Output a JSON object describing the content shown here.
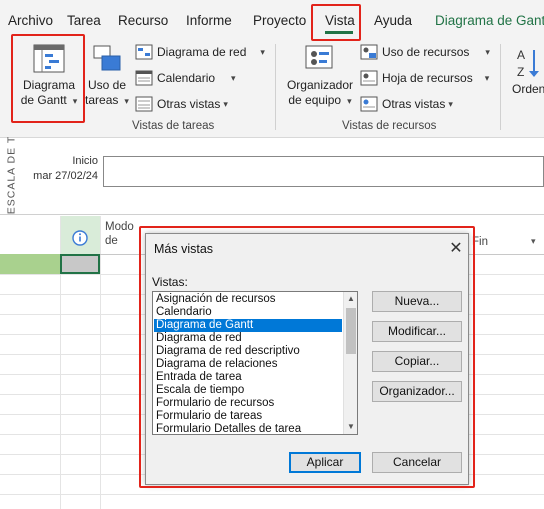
{
  "menu": {
    "items": [
      "Archivo",
      "Tarea",
      "Recurso",
      "Informe",
      "Proyecto",
      "Vista",
      "Ayuda"
    ],
    "context_tab": "Diagrama de Gantt",
    "active": "Vista"
  },
  "ribbon": {
    "task_views": {
      "gantt_label": "Diagrama de Gantt",
      "gantt_label_line1": "Diagrama",
      "gantt_label_line2": "de Gantt",
      "task_usage_line1": "Uso de",
      "task_usage_line2": "tareas",
      "network_diagram": "Diagrama de red",
      "calendar": "Calendario",
      "other_views": "Otras vistas",
      "group_label": "Vistas de tareas"
    },
    "resource_views": {
      "team_planner_line1": "Organizador",
      "team_planner_line2": "de equipo",
      "resource_usage": "Uso de recursos",
      "resource_sheet": "Hoja de recursos",
      "other_views": "Otras vistas",
      "group_label": "Vistas de recursos"
    },
    "sort_label": "Orden"
  },
  "timeline": {
    "vertical_label": "ESCALA DE T",
    "start_label": "Inicio",
    "start_date": "mar 27/02/24"
  },
  "grid": {
    "col_mode_line1": "Modo",
    "col_mode_line2": "de",
    "col_end": "Fin"
  },
  "dialog": {
    "title": "Más vistas",
    "views_label": "Vistas:",
    "views": [
      "Asignación de recursos",
      "Calendario",
      "Diagrama de Gantt",
      "Diagrama de red",
      "Diagrama de red descriptivo",
      "Diagrama de relaciones",
      "Entrada de tarea",
      "Escala de tiempo",
      "Formulario de recursos",
      "Formulario de tareas",
      "Formulario Detalles de tarea"
    ],
    "selected_view": "Diagrama de Gantt",
    "buttons": {
      "new": "Nueva...",
      "edit": "Modificar...",
      "copy": "Copiar...",
      "organizer": "Organizador...",
      "apply": "Aplicar",
      "cancel": "Cancelar"
    }
  },
  "colors": {
    "accent_green": "#217346",
    "highlight_red": "#e2231a",
    "selection_blue": "#0078d7"
  }
}
